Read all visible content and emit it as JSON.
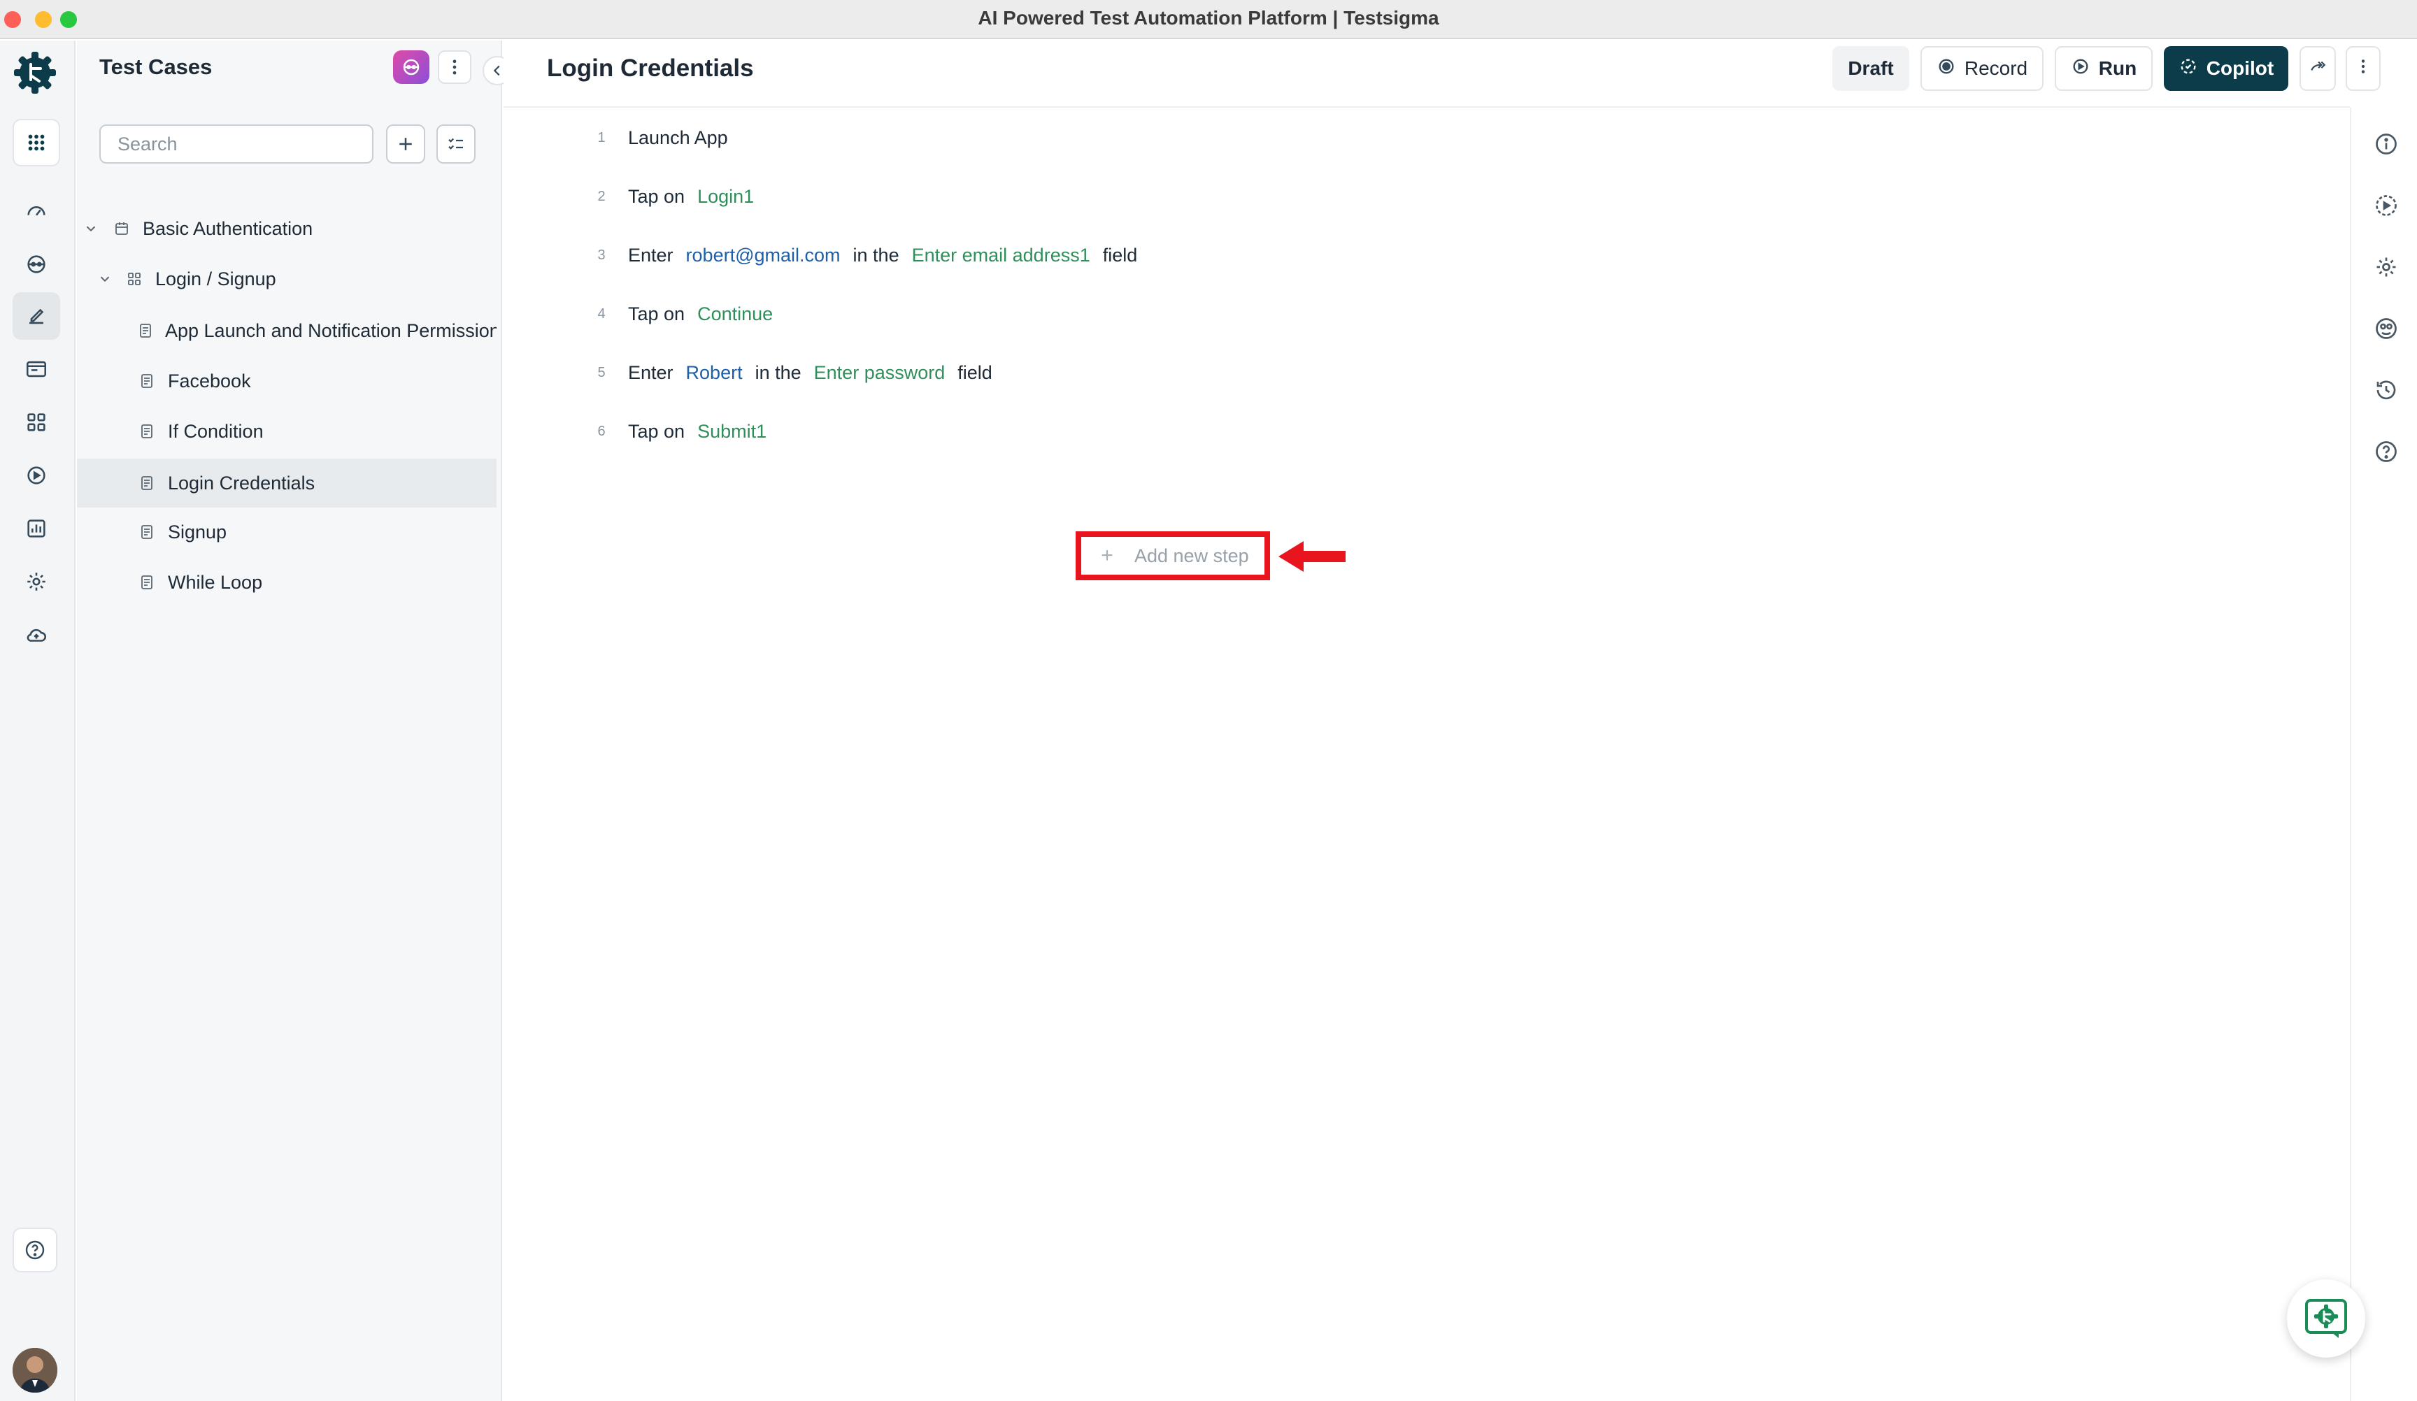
{
  "window": {
    "title": "AI Powered Test Automation Platform | Testsigma"
  },
  "rail": {
    "items": [
      "apps-icon",
      "dashboard-icon",
      "agent-icon",
      "edit-icon",
      "folder-icon",
      "grid-icon",
      "play-icon",
      "report-icon",
      "settings-icon",
      "cloud-icon"
    ],
    "active": "edit-icon",
    "help_icon": "help-icon"
  },
  "panel": {
    "title": "Test Cases",
    "search_placeholder": "Search",
    "tree": [
      {
        "label": "Basic Authentication",
        "level": 0,
        "type": "suite",
        "expanded": true
      },
      {
        "label": "Login / Signup",
        "level": 1,
        "type": "group",
        "expanded": true
      },
      {
        "label": "App Launch and Notification Permission",
        "level": 2,
        "type": "case"
      },
      {
        "label": "Facebook",
        "level": 2,
        "type": "case"
      },
      {
        "label": "If Condition",
        "level": 2,
        "type": "case"
      },
      {
        "label": "Login Credentials",
        "level": 2,
        "type": "case",
        "selected": true
      },
      {
        "label": "Signup",
        "level": 2,
        "type": "case"
      },
      {
        "label": "While Loop",
        "level": 2,
        "type": "case"
      }
    ]
  },
  "header": {
    "title": "Login Credentials",
    "draft_label": "Draft",
    "record_label": "Record",
    "run_label": "Run",
    "copilot_label": "Copilot"
  },
  "steps": [
    {
      "num": "1",
      "tokens": [
        {
          "t": "Launch App",
          "k": "text"
        }
      ]
    },
    {
      "num": "2",
      "tokens": [
        {
          "t": "Tap on",
          "k": "text"
        },
        {
          "t": "Login1",
          "k": "green"
        }
      ]
    },
    {
      "num": "3",
      "tokens": [
        {
          "t": "Enter",
          "k": "text"
        },
        {
          "t": "robert@gmail.com",
          "k": "blue"
        },
        {
          "t": "in the",
          "k": "text"
        },
        {
          "t": "Enter email address1",
          "k": "green"
        },
        {
          "t": "field",
          "k": "text"
        }
      ]
    },
    {
      "num": "4",
      "tokens": [
        {
          "t": "Tap on",
          "k": "text"
        },
        {
          "t": "Continue",
          "k": "green"
        }
      ]
    },
    {
      "num": "5",
      "tokens": [
        {
          "t": "Enter",
          "k": "text"
        },
        {
          "t": "Robert",
          "k": "blue"
        },
        {
          "t": "in the",
          "k": "text"
        },
        {
          "t": "Enter password",
          "k": "green"
        },
        {
          "t": "field",
          "k": "text"
        }
      ]
    },
    {
      "num": "6",
      "tokens": [
        {
          "t": "Tap on",
          "k": "text"
        },
        {
          "t": "Submit1",
          "k": "green"
        }
      ]
    }
  ],
  "add_step": {
    "label": "Add new step",
    "highlight_color": "#e8141e"
  },
  "right_rail": [
    "info-icon",
    "play-settings-icon",
    "gear-icon",
    "test-data-icon",
    "history-icon",
    "help-icon"
  ],
  "colors": {
    "copilot_bg": "#0c3b4a",
    "element_green": "#2f8f5b",
    "data_blue": "#1d5fa8"
  }
}
